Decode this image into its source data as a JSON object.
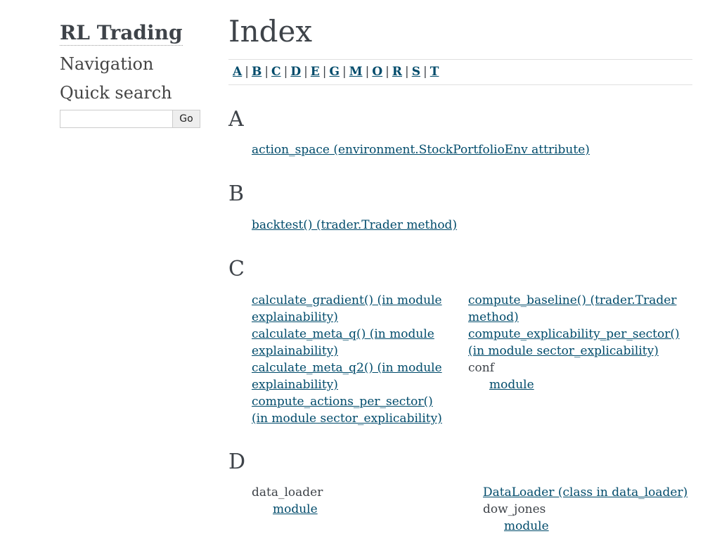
{
  "sidebar": {
    "brand": "RL Trading",
    "navigation_heading": "Navigation",
    "quick_search_heading": "Quick search",
    "search_value": "",
    "go_label": "Go"
  },
  "main": {
    "title": "Index",
    "letters": [
      "A",
      "B",
      "C",
      "D",
      "E",
      "G",
      "M",
      "O",
      "R",
      "S",
      "T"
    ],
    "sections": {
      "A": {
        "heading": "A",
        "entries": [
          "action_space (environment.StockPortfolioEnv attribute)"
        ]
      },
      "B": {
        "heading": "B",
        "entries": [
          "backtest() (trader.Trader method)"
        ]
      },
      "C": {
        "heading": "C",
        "left": [
          [
            "calculate_gradient() (in module",
            "explainability)"
          ],
          [
            "calculate_meta_q() (in module",
            "explainability)"
          ],
          [
            "calculate_meta_q2() (in module",
            "explainability)"
          ],
          [
            "compute_actions_per_sector()",
            "(in module sector_explicability)"
          ]
        ],
        "right": [
          [
            "compute_baseline() (trader.Trader",
            "method)"
          ],
          [
            "compute_explicability_per_sector()",
            "(in module sector_explicability)"
          ]
        ],
        "conf_label": "conf",
        "conf_module": "module"
      },
      "D": {
        "heading": "D",
        "data_loader_label": "data_loader",
        "data_loader_module": "module",
        "dataloader_class": "DataLoader (class in data_loader)",
        "dow_jones_label": "dow_jones",
        "dow_jones_module": "module"
      }
    }
  }
}
